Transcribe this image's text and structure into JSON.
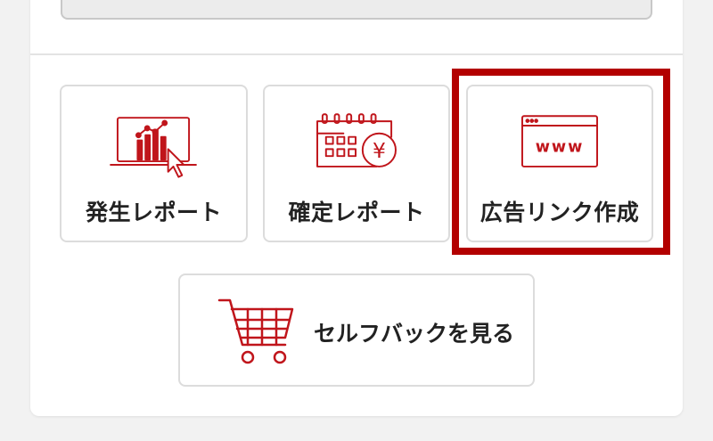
{
  "tiles": [
    {
      "label": "発生レポート",
      "icon": "laptop-chart-icon"
    },
    {
      "label": "確定レポート",
      "icon": "calendar-yen-icon"
    },
    {
      "label": "広告リンク作成",
      "icon": "browser-www-icon"
    }
  ],
  "selfback": {
    "label": "セルフバックを見る",
    "icon": "shopping-cart-icon"
  },
  "www_text": "www",
  "yen_symbol": "¥",
  "colors": {
    "accent": "#c0151b",
    "highlight": "#b30000"
  }
}
